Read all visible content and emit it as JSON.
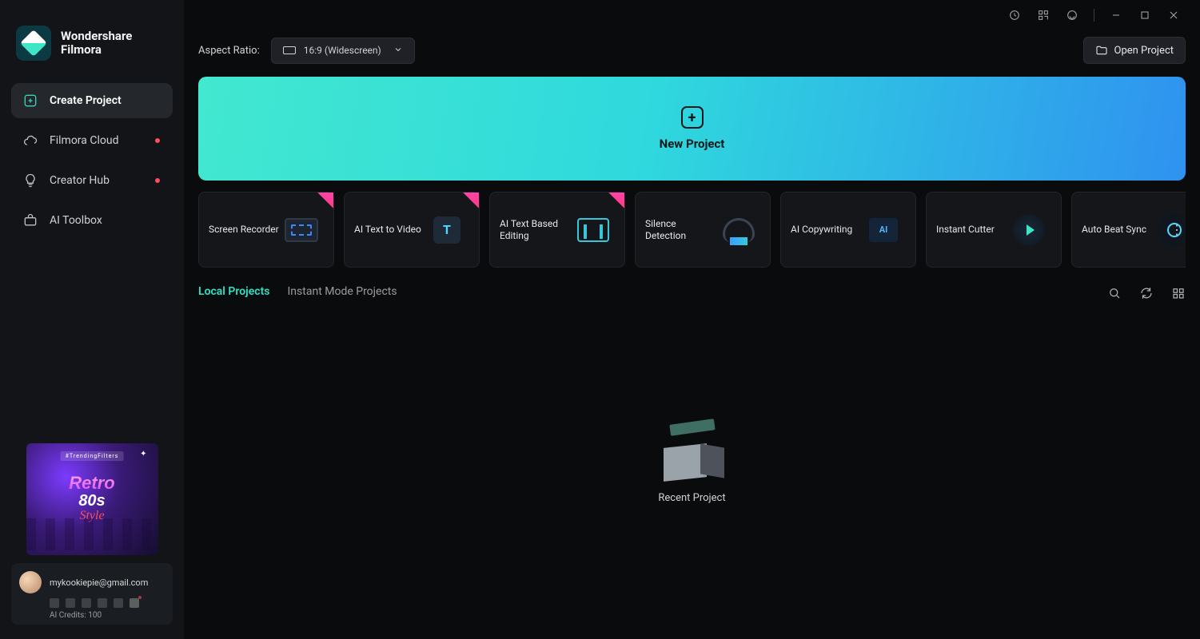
{
  "brand": {
    "top": "Wondershare",
    "bottom": "Filmora"
  },
  "sidebar": {
    "items": [
      {
        "label": "Create Project",
        "icon": "plus-square-icon",
        "active": true,
        "dot": false
      },
      {
        "label": "Filmora Cloud",
        "icon": "cloud-icon",
        "active": false,
        "dot": true
      },
      {
        "label": "Creator Hub",
        "icon": "bulb-icon",
        "active": false,
        "dot": true
      },
      {
        "label": "AI Toolbox",
        "icon": "ai-toolbox-icon",
        "active": false,
        "dot": false
      }
    ],
    "promo": {
      "tag": "#TrendingFilters",
      "line1": "Retro",
      "line2": "80s",
      "line3": "Style"
    },
    "user": {
      "email": "mykookiepie@gmail.com",
      "credits": "AI Credits: 100"
    }
  },
  "titlebar": {
    "icons": [
      "updates-icon",
      "qrcode-icon",
      "support-icon"
    ],
    "window": [
      "minimize",
      "maximize",
      "close"
    ]
  },
  "toolbar": {
    "aspect_label": "Aspect Ratio:",
    "aspect_value": "16:9 (Widescreen)",
    "open_label": "Open Project"
  },
  "hero": {
    "label": "New Project"
  },
  "cards": [
    {
      "label": "Screen Recorder",
      "new": true,
      "thumb": "th-rec"
    },
    {
      "label": "AI Text to Video",
      "new": true,
      "thumb": "th-txt"
    },
    {
      "label": "AI Text Based Editing",
      "new": true,
      "thumb": "th-brk"
    },
    {
      "label": "Silence Detection",
      "new": false,
      "thumb": "th-head"
    },
    {
      "label": "AI Copywriting",
      "new": false,
      "thumb": "th-ai"
    },
    {
      "label": "Instant Cutter",
      "new": false,
      "thumb": "th-play"
    },
    {
      "label": "Auto Beat Sync",
      "new": false,
      "thumb": "th-beat"
    }
  ],
  "tabs": {
    "items": [
      {
        "label": "Local Projects",
        "active": true
      },
      {
        "label": "Instant Mode Projects",
        "active": false
      }
    ]
  },
  "stage": {
    "recent_label": "Recent Project"
  }
}
